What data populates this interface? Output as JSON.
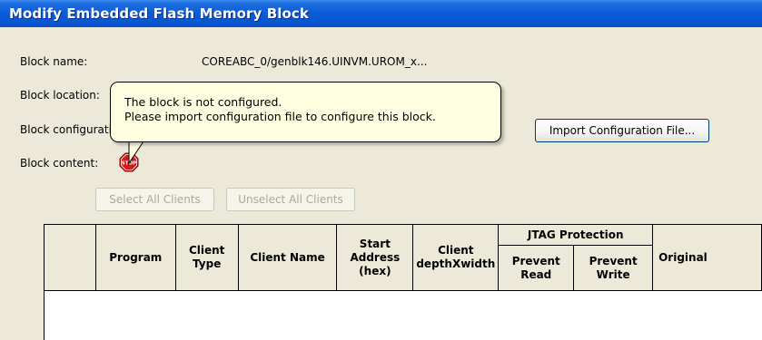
{
  "window": {
    "title": "Modify Embedded Flash Memory Block"
  },
  "fields": {
    "block_name_label": "Block name:",
    "block_name_value": "COREABC_0/genblk146.UINVM.UROM_x...",
    "block_location_label": "Block location:",
    "block_configuration_label": "Block configurati",
    "block_content_label": "Block content:"
  },
  "tooltip": {
    "line1": "The block is not configured.",
    "line2": "Please import configuration file to configure this block."
  },
  "buttons": {
    "import_config": "Import Configuration File...",
    "select_all_clients": "Select All Clients",
    "unselect_all_clients": "Unselect All Clients"
  },
  "table": {
    "columns": {
      "program": "Program",
      "client_type": "Client Type",
      "client_name": "Client Name",
      "start_address_1": "Start",
      "start_address_2": "Address",
      "start_address_3": "(hex)",
      "client_depth_1": "Client",
      "client_depth_2": "depthXwidth",
      "jtag_protection": "JTAG Protection",
      "prevent_read_1": "Prevent",
      "prevent_read_2": "Read",
      "prevent_write_1": "Prevent",
      "prevent_write_2": "Write",
      "original": "Original"
    }
  },
  "icons": {
    "stop": "stop-sign-icon",
    "stop_text": "STOP"
  },
  "colors": {
    "titlebar": "#0a5bd6",
    "tooltip_bg": "#ffffe1",
    "dialog_bg": "#ece9d8",
    "stop_red": "#d21a1a"
  }
}
